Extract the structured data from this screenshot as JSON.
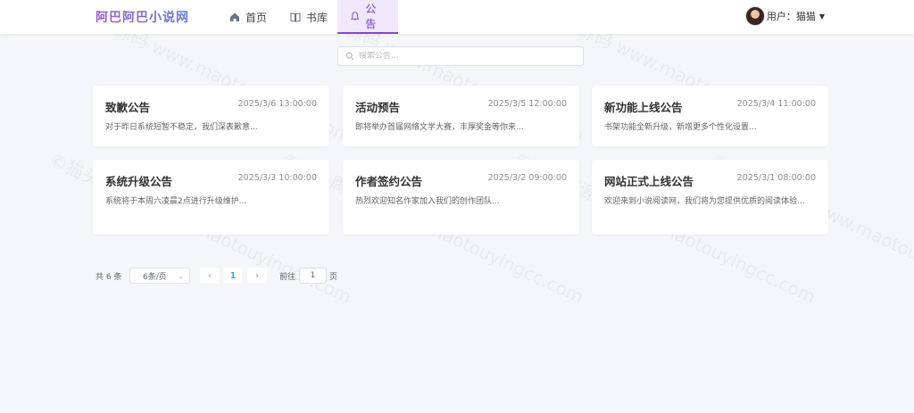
{
  "header": {
    "logo": "阿巴阿巴小说网",
    "nav": [
      {
        "label": "首页",
        "icon": "home-icon"
      },
      {
        "label": "书库",
        "icon": "book-icon"
      },
      {
        "label": "公告",
        "icon": "bell-icon",
        "active": true
      }
    ],
    "user_label": "用户：猫猫"
  },
  "search": {
    "placeholder": "搜索公告..."
  },
  "notices": [
    {
      "title": "致歉公告",
      "date": "2025/3/6 13:00:00",
      "desc": "对于昨日系统短暂不稳定，我们深表歉意..."
    },
    {
      "title": "活动预告",
      "date": "2025/3/5 12:00:00",
      "desc": "即将举办首届网络文学大赛，丰厚奖金等你来..."
    },
    {
      "title": "新功能上线公告",
      "date": "2025/3/4 11:00:00",
      "desc": "书架功能全新升级，新增更多个性化设置..."
    },
    {
      "title": "系统升级公告",
      "date": "2025/3/3 10:00:00",
      "desc": "系统将于本周六凌晨2点进行升级维护..."
    },
    {
      "title": "作者签约公告",
      "date": "2025/3/2 09:00:00",
      "desc": "热烈欢迎知名作家加入我们的创作团队..."
    },
    {
      "title": "网站正式上线公告",
      "date": "2025/3/1 08:00:00",
      "desc": "欢迎来到小说阅读网，我们将为您提供优质的阅读体验..."
    }
  ],
  "pagination": {
    "total_text": "共 6 条",
    "page_size": "6条/页",
    "prev": "‹",
    "current_page": "1",
    "next": "›",
    "goto_label": "前往",
    "goto_value": "1",
    "page_unit": "页"
  },
  "watermark": "©猫头鹰源码 www.maotouyingcc.com",
  "colors": {
    "accent": "#7d4ad1",
    "link": "#409eff",
    "background": "#f5f6fa"
  }
}
